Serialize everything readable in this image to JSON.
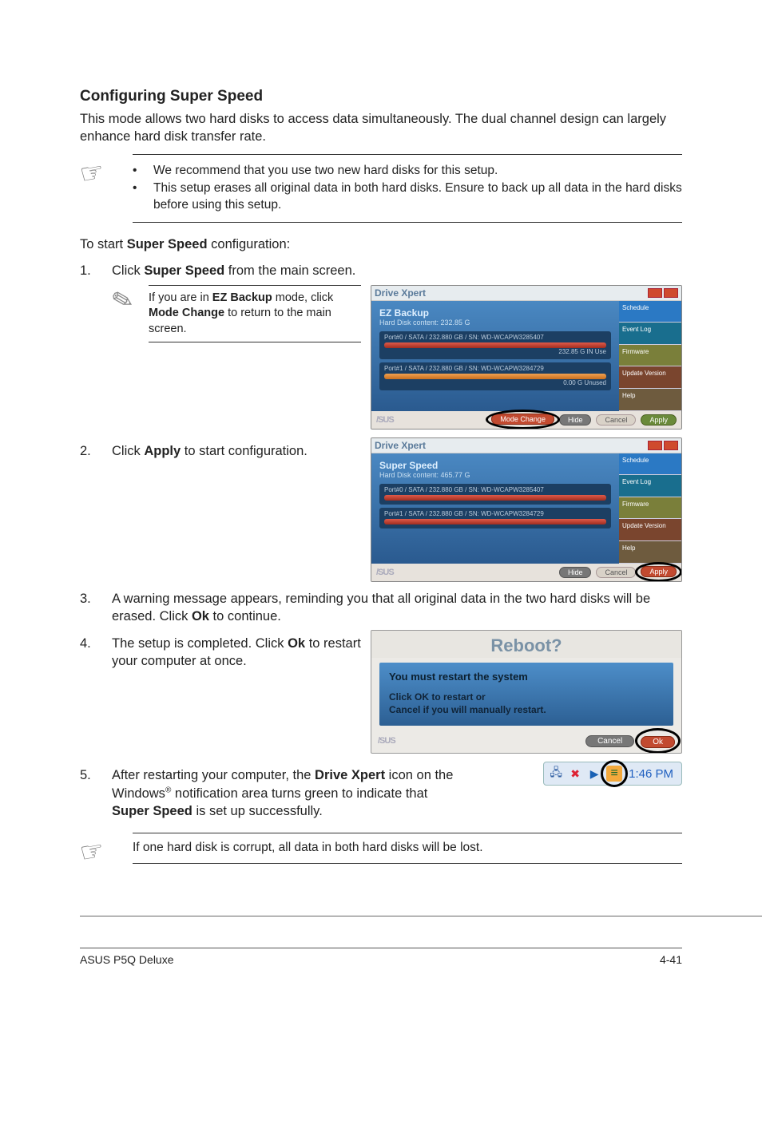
{
  "section": {
    "title": "Configuring Super Speed",
    "intro": "This mode allows two hard disks to access data simultaneously. The dual channel design can largely enhance hard disk transfer rate."
  },
  "firstNote": {
    "bullets": [
      "We recommend that you use two new hard disks for this setup.",
      "This setup erases all original data in both hard disks. Ensure to back up all data in the hard disks before using this setup."
    ]
  },
  "toStart": {
    "prefix": "To start ",
    "bold": "Super Speed",
    "suffix": " configuration:"
  },
  "steps": {
    "s1": {
      "num": "1.",
      "pre": "Click ",
      "bold": "Super Speed",
      "post": " from the main screen."
    },
    "s2": {
      "num": "2.",
      "pre": "Click ",
      "bold": "Apply",
      "post": " to start configuration."
    },
    "s3": {
      "num": "3.",
      "text_a": "A warning message appears, reminding you that all original data in the two hard disks will be erased. Click ",
      "bold": "Ok",
      "text_b": " to continue."
    },
    "s4": {
      "num": "4.",
      "text_a": "The setup is completed. Click ",
      "bold": "Ok",
      "text_b": " to restart your computer at once."
    },
    "s5": {
      "num": "5.",
      "t1": "After restarting your computer, the ",
      "b1": "Drive Xpert",
      "t2": " icon on the Windows",
      "reg": "®",
      "t3": " notification area turns green to indicate that ",
      "b2": "Super Speed",
      "t4": " is set up successfully."
    }
  },
  "miniNote": {
    "a": "If you are in ",
    "b1": "EZ Backup",
    "b": " mode, click ",
    "b2": "Mode Change",
    "c": " to return to the main screen."
  },
  "dx1": {
    "title": "Drive Xpert",
    "mode": "EZ Backup",
    "sub": "Hard Disk content: 232.85 G",
    "disk1": "Port#0 / SATA / 232.880 GB / SN: WD-WCAPW3285407",
    "disk1b": "232.85 G  IN Use",
    "disk2": "Port#1 / SATA / 232.880 GB / SN: WD-WCAPW3284729",
    "disk2b": "0.00 G  Unused",
    "side": [
      "Schedule",
      "Event Log",
      "Firmware",
      "Update Version",
      "Help"
    ],
    "btns": {
      "mode": "Mode Change",
      "hide": "Hide",
      "cancel": "Cancel",
      "apply": "Apply"
    }
  },
  "dx2": {
    "title": "Drive Xpert",
    "mode": "Super Speed",
    "sub": "Hard Disk content: 465.77 G",
    "disk1": "Port#0 / SATA / 232.880 GB / SN: WD-WCAPW3285407",
    "disk2": "Port#1 / SATA / 232.880 GB / SN: WD-WCAPW3284729",
    "side": [
      "Schedule",
      "Event Log",
      "Firmware",
      "Update Version",
      "Help"
    ],
    "btns": {
      "hide": "Hide",
      "cancel": "Cancel",
      "apply": "Apply"
    }
  },
  "reboot": {
    "title": "Reboot?",
    "line1": "You must restart the system",
    "line2a": "Click OK to restart or",
    "line2b": "Cancel if you will manually restart.",
    "cancel": "Cancel",
    "ok": "Ok"
  },
  "tray": {
    "time": "1:46 PM"
  },
  "lastNote": "If one hard disk is corrupt, all data in both hard disks will be lost.",
  "footer": {
    "left": "ASUS P5Q Deluxe",
    "right": "4-41"
  },
  "logo": "/SUS"
}
